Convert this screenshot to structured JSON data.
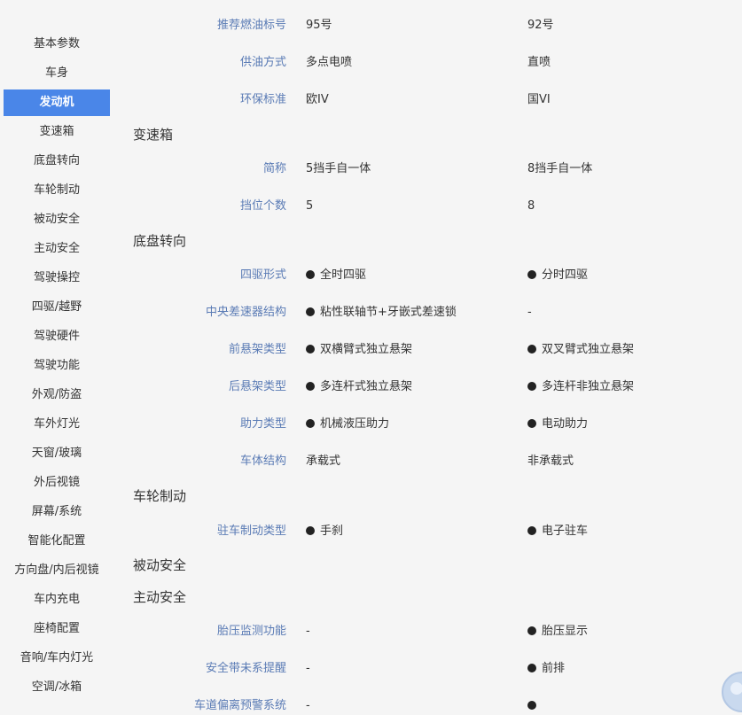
{
  "sidebar": {
    "items": [
      {
        "label": "基本参数",
        "active": false
      },
      {
        "label": "车身",
        "active": false
      },
      {
        "label": "发动机",
        "active": true
      },
      {
        "label": "变速箱",
        "active": false
      },
      {
        "label": "底盘转向",
        "active": false
      },
      {
        "label": "车轮制动",
        "active": false
      },
      {
        "label": "被动安全",
        "active": false
      },
      {
        "label": "主动安全",
        "active": false
      },
      {
        "label": "驾驶操控",
        "active": false
      },
      {
        "label": "四驱/越野",
        "active": false
      },
      {
        "label": "驾驶硬件",
        "active": false
      },
      {
        "label": "驾驶功能",
        "active": false
      },
      {
        "label": "外观/防盗",
        "active": false
      },
      {
        "label": "车外灯光",
        "active": false
      },
      {
        "label": "天窗/玻璃",
        "active": false
      },
      {
        "label": "外后视镜",
        "active": false
      },
      {
        "label": "屏幕/系统",
        "active": false
      },
      {
        "label": "智能化配置",
        "active": false
      },
      {
        "label": "方向盘/内后视镜",
        "active": false
      },
      {
        "label": "车内充电",
        "active": false
      },
      {
        "label": "座椅配置",
        "active": false
      },
      {
        "label": "音响/车内灯光",
        "active": false
      },
      {
        "label": "空调/冰箱",
        "active": false
      }
    ]
  },
  "sections": [
    {
      "title": "",
      "rows": [
        {
          "label": "推荐燃油标号",
          "v1": "95号",
          "v1_dot": false,
          "v2": "92号",
          "v2_dot": false
        },
        {
          "label": "供油方式",
          "v1": "多点电喷",
          "v1_dot": false,
          "v2": "直喷",
          "v2_dot": false
        },
        {
          "label": "环保标准",
          "v1": "欧IV",
          "v1_dot": false,
          "v2": "国VI",
          "v2_dot": false
        }
      ]
    },
    {
      "title": "变速箱",
      "rows": [
        {
          "label": "简称",
          "v1": "5挡手自一体",
          "v1_dot": false,
          "v2": "8挡手自一体",
          "v2_dot": false
        },
        {
          "label": "挡位个数",
          "v1": "5",
          "v1_dot": false,
          "v2": "8",
          "v2_dot": false
        }
      ]
    },
    {
      "title": "底盘转向",
      "rows": [
        {
          "label": "四驱形式",
          "v1": "全时四驱",
          "v1_dot": true,
          "v2": "分时四驱",
          "v2_dot": true
        },
        {
          "label": "中央差速器结构",
          "v1": "粘性联轴节+牙嵌式差速锁",
          "v1_dot": true,
          "v2": "-",
          "v2_dot": false
        },
        {
          "label": "前悬架类型",
          "v1": "双横臂式独立悬架",
          "v1_dot": true,
          "v2": "双叉臂式独立悬架",
          "v2_dot": true
        },
        {
          "label": "后悬架类型",
          "v1": "多连杆式独立悬架",
          "v1_dot": true,
          "v2": "多连杆非独立悬架",
          "v2_dot": true
        },
        {
          "label": "助力类型",
          "v1": "机械液压助力",
          "v1_dot": true,
          "v2": "电动助力",
          "v2_dot": true
        },
        {
          "label": "车体结构",
          "v1": "承载式",
          "v1_dot": false,
          "v2": "非承载式",
          "v2_dot": false
        }
      ]
    },
    {
      "title": "车轮制动",
      "rows": [
        {
          "label": "驻车制动类型",
          "v1": "手刹",
          "v1_dot": true,
          "v2": "电子驻车",
          "v2_dot": true
        }
      ]
    },
    {
      "title": "被动安全",
      "rows": []
    },
    {
      "title": "主动安全",
      "rows": [
        {
          "label": "胎压监测功能",
          "v1": "-",
          "v1_dot": false,
          "v2": "胎压显示",
          "v2_dot": true
        },
        {
          "label": "安全带未系提醒",
          "v1": "-",
          "v1_dot": false,
          "v2": "前排",
          "v2_dot": true
        },
        {
          "label": "车道偏离预警系统",
          "v1": "-",
          "v1_dot": false,
          "v2": "",
          "v2_dot": true
        }
      ]
    }
  ]
}
